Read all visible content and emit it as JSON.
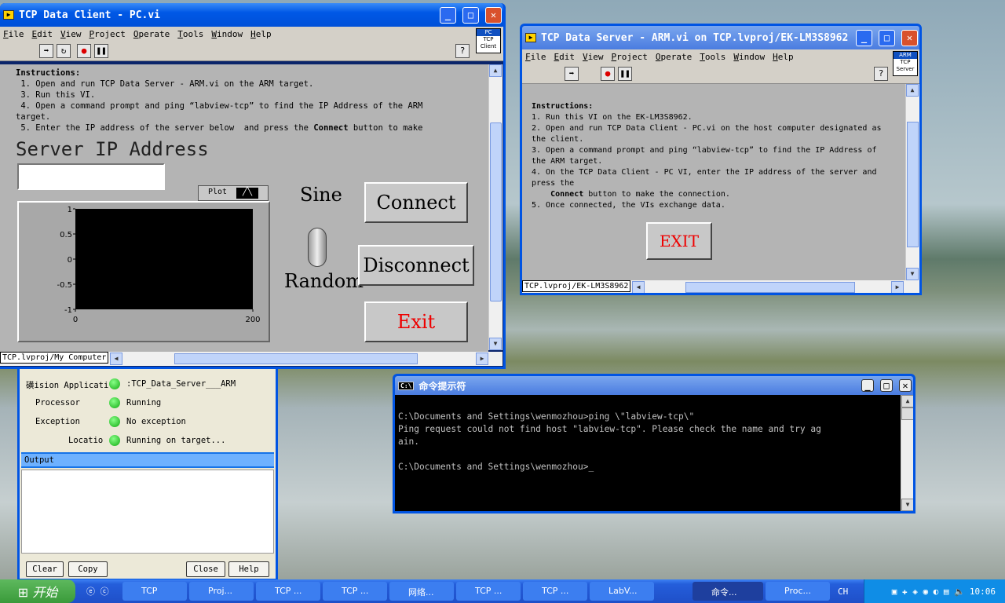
{
  "client": {
    "title": "TCP Data Client - PC.vi",
    "menu": [
      "File",
      "Edit",
      "View",
      "Project",
      "Operate",
      "Tools",
      "Window",
      "Help"
    ],
    "vi_icon": [
      "PC",
      "TCP",
      "Client"
    ],
    "instructions_heading": "Instructions:",
    "instructions": [
      " 1. Open and run TCP Data Server - ARM.vi on the ARM target.",
      " 3. Run this VI.",
      " 4. Open a command prompt and ping “labview-tcp” to find the IP Address of the ARM\ntarget.",
      " 5. Enter the IP address of the server below  and press the "
    ],
    "instr_bold": "Connect",
    "instr_tail": " button to make",
    "server_ip_label": "Server IP Address",
    "server_ip_value": "",
    "plot_legend": "Plot",
    "sine_label": "Sine",
    "random_label": "Random",
    "connect": "Connect",
    "disconnect": "Disconnect",
    "exit": "Exit",
    "status_path": "TCP.lvproj/My Computer"
  },
  "chart_data": {
    "type": "line",
    "series": [],
    "xlim": [
      0,
      200
    ],
    "ylim": [
      -1,
      1
    ],
    "x_ticks": [
      "0",
      "200"
    ],
    "y_ticks": [
      "1",
      "0.5",
      "0",
      "-0.5",
      "-1"
    ],
    "background": "#000000",
    "grid": false
  },
  "server": {
    "title": "TCP Data Server - ARM.vi on TCP.lvproj/EK-LM3S8962",
    "menu": [
      "File",
      "Edit",
      "View",
      "Project",
      "Operate",
      "Tools",
      "Window",
      "Help"
    ],
    "vi_icon": [
      "ARM",
      "TCP",
      "Server"
    ],
    "instructions_heading": "Instructions:",
    "instructions": [
      "1. Run this VI on the EK-LM3S8962.",
      "2. Open and run TCP Data Client - PC.vi on the host computer designated as\nthe client.",
      "3. Open a command prompt and ping “labview-tcp” to find the IP Address of\nthe ARM target.",
      "4. On the TCP Data Client - PC VI, enter the IP address of the server and\npress the"
    ],
    "instr_bold": "Connect",
    "instr_tail": " button to make the connection.",
    "instr_last": "5. Once connected, the VIs exchange data.",
    "exit": "EXIT",
    "status_path": "TCP.lvproj/EK-LM3S8962"
  },
  "status_window": {
    "rows": [
      {
        "label": "磺ision Applicati",
        "value": ":TCP_Data_Server___ARM"
      },
      {
        "label": "Processor",
        "value": "Running"
      },
      {
        "label": "Exception",
        "value": "No exception"
      },
      {
        "label": "Locatio",
        "value": "Running on target..."
      }
    ],
    "output_label": "Output",
    "buttons": {
      "clear": "Clear",
      "copy": "Copy",
      "close": "Close",
      "help": "Help"
    }
  },
  "cmd": {
    "title": "命令提示符",
    "lines": [
      "",
      "C:\\Documents and Settings\\wenmozhou>ping \\\"labview-tcp\\\"",
      "Ping request could not find host \"labview-tcp\". Please check the name and try ag",
      "ain.",
      "",
      "C:\\Documents and Settings\\wenmozhou>_"
    ]
  },
  "taskbar": {
    "start": "开始",
    "items": [
      "TCP",
      "Proj...",
      "TCP ...",
      "TCP ...",
      "网络...",
      "TCP ...",
      "TCP ...",
      "LabV...",
      "命令...",
      "Proc..."
    ],
    "lang": "CH",
    "clock": "10:06"
  }
}
